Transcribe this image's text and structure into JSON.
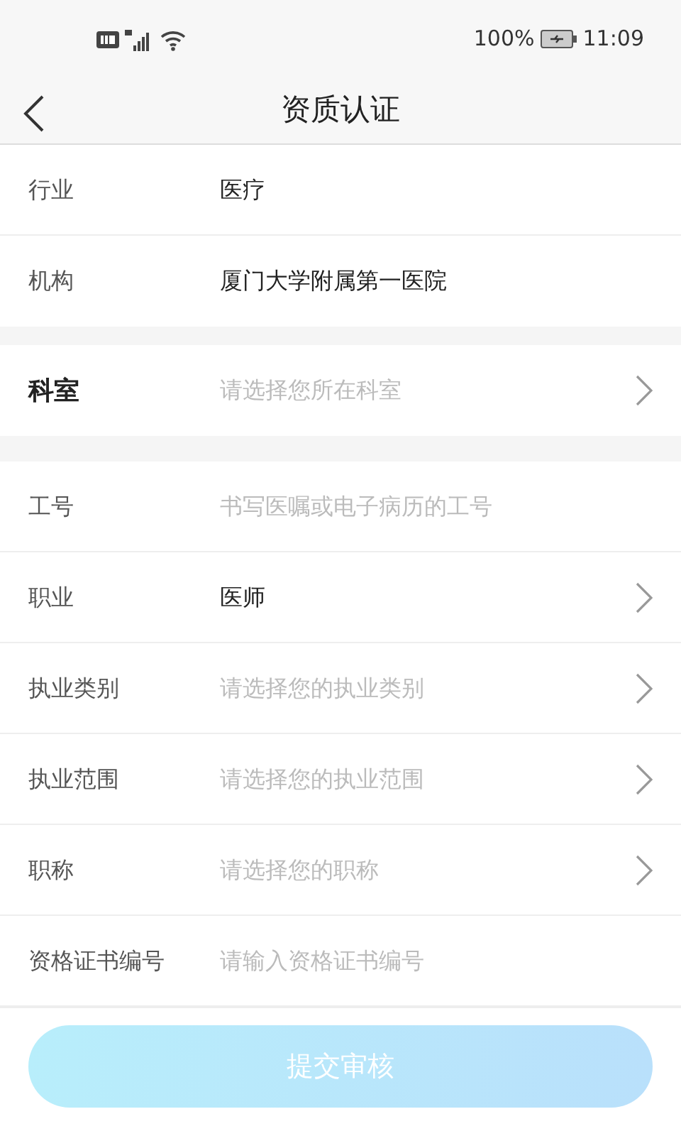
{
  "status_bar": {
    "battery_text": "100%",
    "time": "11:09"
  },
  "header": {
    "title": "资质认证"
  },
  "sections": [
    {
      "rows": [
        {
          "label": "行业",
          "kind": "text",
          "emphasized": false,
          "value": "医疗"
        },
        {
          "label": "机构",
          "kind": "text",
          "emphasized": false,
          "value": "厦门大学附属第一医院"
        }
      ]
    },
    {
      "rows": [
        {
          "label": "科室",
          "kind": "select",
          "emphasized": true,
          "placeholder": "请选择您所在科室"
        }
      ]
    },
    {
      "rows": [
        {
          "label": "工号",
          "kind": "input",
          "emphasized": false,
          "placeholder": "书写医嘱或电子病历的工号"
        },
        {
          "label": "职业",
          "kind": "select",
          "emphasized": false,
          "value": "医师"
        },
        {
          "label": "执业类别",
          "kind": "select",
          "emphasized": false,
          "placeholder": "请选择您的执业类别"
        },
        {
          "label": "执业范围",
          "kind": "select",
          "emphasized": false,
          "placeholder": "请选择您的执业范围"
        },
        {
          "label": "职称",
          "kind": "select",
          "emphasized": false,
          "placeholder": "请选择您的职称"
        },
        {
          "label": "资格证书编号",
          "kind": "input",
          "emphasized": false,
          "placeholder": "请输入资格证书编号"
        }
      ]
    }
  ],
  "submit": {
    "label": "提交审核",
    "disabled": true
  }
}
